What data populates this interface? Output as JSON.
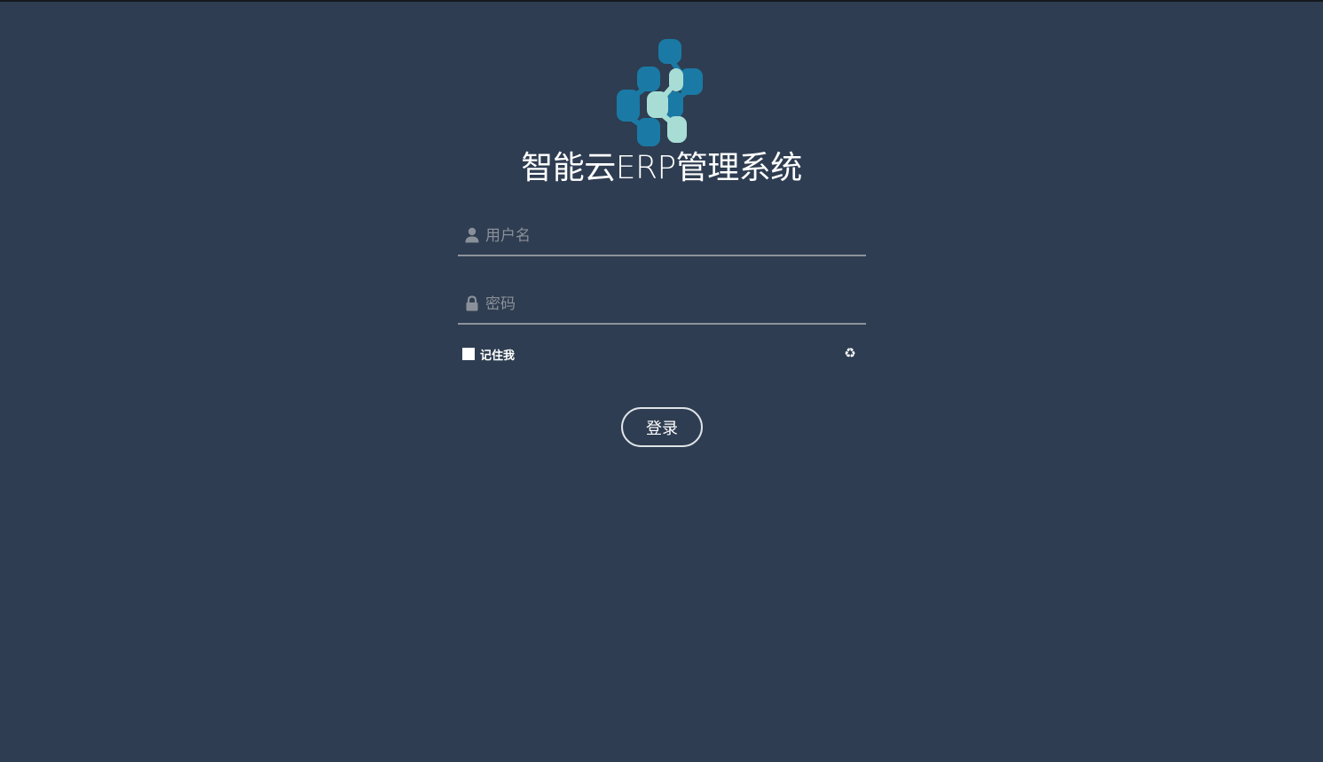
{
  "app": {
    "title": "智能云ERP管理系统"
  },
  "login_form": {
    "username": {
      "value": "",
      "placeholder": "用户名",
      "icon": "user-icon"
    },
    "password": {
      "value": "",
      "placeholder": "密码",
      "icon": "lock-icon"
    },
    "remember_me": {
      "label": "记住我",
      "checked": false
    },
    "refresh_icon": "♻",
    "submit_label": "登录"
  },
  "colors": {
    "background": "#2e3d51",
    "logo_dark": "#1a7aa5",
    "logo_light": "#a8ddd6",
    "text": "#ffffff",
    "placeholder": "#8a9099",
    "underline": "#8d939a"
  }
}
